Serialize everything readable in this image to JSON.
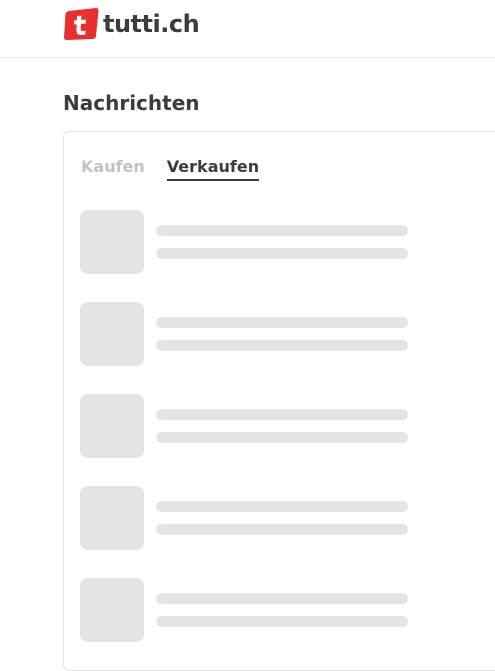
{
  "header": {
    "brand_name": "tutti.ch",
    "brand_color": "#e8312f",
    "logo_icon": "tutti-logo-icon"
  },
  "page": {
    "title": "Nachrichten"
  },
  "tabs": [
    {
      "label": "Kaufen",
      "active": false
    },
    {
      "label": "Verkaufen",
      "active": true
    }
  ],
  "conversation_list": {
    "state": "loading",
    "placeholder_rows": 5
  },
  "colors": {
    "text_primary": "#3c3c3c",
    "text_inactive": "#c2c2c2",
    "skeleton": "#e4e4e4",
    "border": "#e3e3e3"
  }
}
